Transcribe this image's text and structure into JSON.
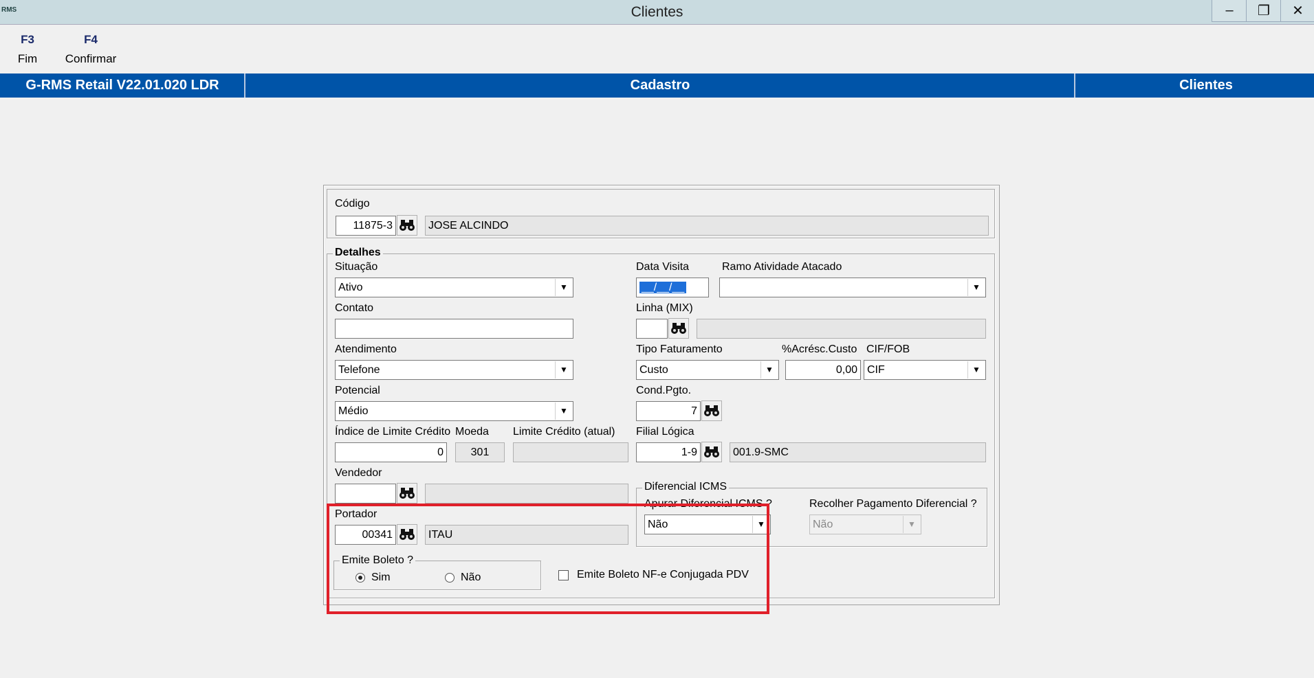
{
  "window": {
    "title": "Clientes",
    "app_icon": "RMS",
    "minimize": "–",
    "restore": "❐",
    "close": "✕"
  },
  "toolbar": [
    {
      "key": "F3",
      "label": "Fim"
    },
    {
      "key": "F4",
      "label": "Confirmar"
    }
  ],
  "header": {
    "app": "G-RMS Retail V22.01.020 LDR",
    "module": "Cadastro",
    "screen": "Clientes"
  },
  "codigo": {
    "label": "Código",
    "value": "11875-3",
    "name": "JOSE ALCINDO"
  },
  "detalhes": {
    "legend": "Detalhes",
    "situacao": {
      "label": "Situação",
      "value": "Ativo"
    },
    "data_visita": {
      "label": "Data Visita",
      "value": "__/__/__"
    },
    "ramo": {
      "label": "Ramo Atividade Atacado",
      "value": ""
    },
    "contato": {
      "label": "Contato",
      "value": ""
    },
    "linha": {
      "label": "Linha (MIX)",
      "value": "",
      "desc": ""
    },
    "atendimento": {
      "label": "Atendimento",
      "value": "Telefone"
    },
    "tipo_faturamento": {
      "label": "Tipo Faturamento",
      "value": "Custo"
    },
    "acresc": {
      "label": "%Acrésc.Custo",
      "value": "0,00"
    },
    "cif_fob": {
      "label": "CIF/FOB",
      "value": "CIF"
    },
    "potencial": {
      "label": "Potencial",
      "value": "Médio"
    },
    "cond_pgto": {
      "label": "Cond.Pgto.",
      "value": "7"
    },
    "indice_limite": {
      "label": "Índice de Limite Crédito",
      "value": "0"
    },
    "moeda": {
      "label": "Moeda",
      "value": "301"
    },
    "limite_atual": {
      "label": "Limite Crédito (atual)",
      "value": ""
    },
    "filial_logica": {
      "label": "Filial Lógica",
      "value": "1-9",
      "desc": "001.9-SMC"
    },
    "vendedor": {
      "label": "Vendedor",
      "value": "",
      "desc": ""
    },
    "diferencial": {
      "legend": "Diferencial ICMS",
      "apurar": {
        "label": "Apurar Diferencial ICMS ?",
        "value": "Não"
      },
      "recolher": {
        "label": "Recolher Pagamento Diferencial ?",
        "value": "Não"
      }
    },
    "portador": {
      "label": "Portador",
      "value": "00341",
      "desc": "ITAU"
    },
    "emite_boleto": {
      "legend": "Emite Boleto ?",
      "sim": "Sim",
      "nao": "Não",
      "selected": "Sim"
    },
    "emite_nfe": {
      "label": "Emite Boleto NF-e Conjugada PDV",
      "checked": false
    }
  },
  "colors": {
    "header_bar": "#0054a8",
    "highlight": "#e0202a",
    "titlebar": "#c9dbe0"
  }
}
